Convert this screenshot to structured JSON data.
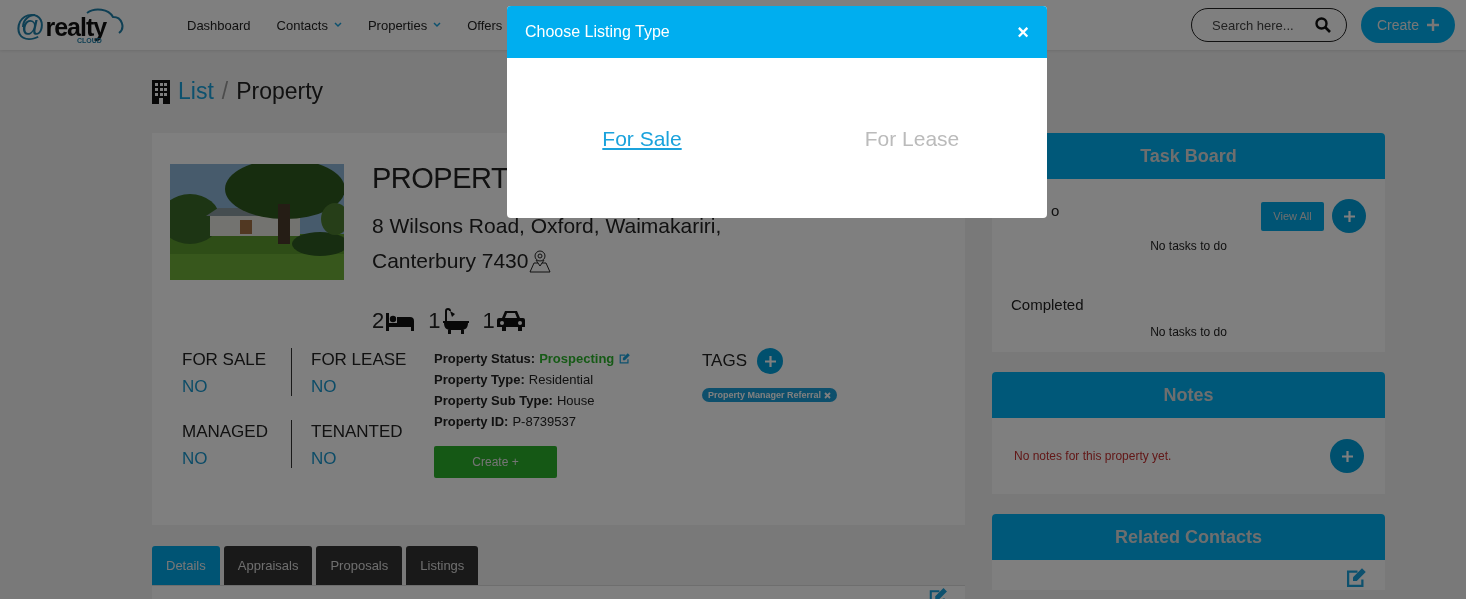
{
  "header": {
    "logo": {
      "at": "@",
      "text": "realty",
      "subtext": "CLOUD"
    },
    "nav": [
      {
        "label": "Dashboard",
        "dropdown": false
      },
      {
        "label": "Contacts",
        "dropdown": true
      },
      {
        "label": "Properties",
        "dropdown": true
      },
      {
        "label": "Offers",
        "dropdown": false
      }
    ],
    "search": {
      "placeholder": "Search here..."
    },
    "create_button": "Create"
  },
  "breadcrumb": {
    "link": "List",
    "separator": "/",
    "current": "Property"
  },
  "property": {
    "title": "PROPERT",
    "address_lines": [
      "8 Wilsons Road, Oxford, Waimakariri,",
      "Canterbury 7430"
    ],
    "features": [
      {
        "kind": "bed",
        "count": "2"
      },
      {
        "kind": "bath",
        "count": "1"
      },
      {
        "kind": "car",
        "count": "1"
      }
    ],
    "flags": [
      {
        "label": "FOR SALE",
        "value": "NO"
      },
      {
        "label": "FOR LEASE",
        "value": "NO"
      },
      {
        "label": "MANAGED",
        "value": "NO"
      },
      {
        "label": "TENANTED",
        "value": "NO"
      }
    ],
    "details": [
      {
        "label": "Property Status:",
        "value": "Prospecting",
        "kind": "status"
      },
      {
        "label": "Property Type:",
        "value": "Residential",
        "kind": "plain"
      },
      {
        "label": "Property Sub Type:",
        "value": "House",
        "kind": "plain"
      },
      {
        "label": "Property ID:",
        "value": "P-8739537",
        "kind": "plain"
      }
    ],
    "create_button": "Create +",
    "tags_title": "TAGS",
    "tags": [
      "Property Manager Referral"
    ]
  },
  "tabs": [
    {
      "label": "Details",
      "selected": true
    },
    {
      "label": "Appraisals",
      "selected": false
    },
    {
      "label": "Proposals",
      "selected": false
    },
    {
      "label": "Listings",
      "selected": false
    }
  ],
  "task_board": {
    "title": "Task Board",
    "view_all": "View All",
    "sections": [
      {
        "label": "o",
        "empty": "No tasks to do"
      },
      {
        "label": "Completed",
        "empty": "No tasks to do"
      }
    ]
  },
  "notes": {
    "title": "Notes",
    "empty": "No notes for this property yet."
  },
  "related_contacts": {
    "title": "Related Contacts"
  },
  "modal": {
    "title": "Choose Listing Type",
    "close": "×",
    "options": [
      {
        "label": "For Sale",
        "enabled": true
      },
      {
        "label": "For Lease",
        "enabled": false
      }
    ]
  }
}
